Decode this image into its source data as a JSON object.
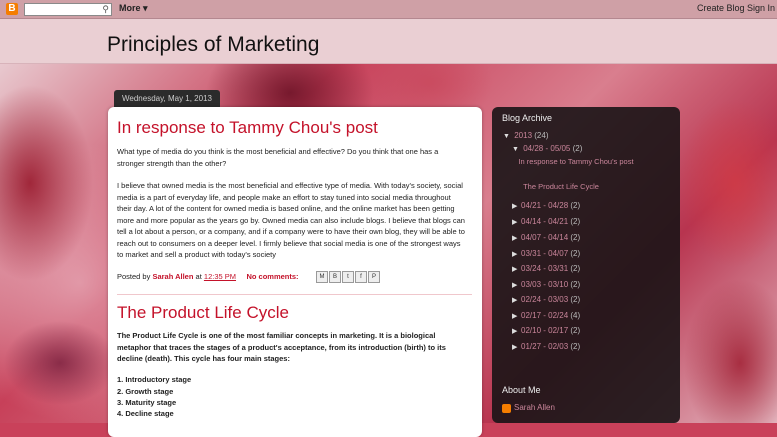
{
  "topbar": {
    "more": "More ▾",
    "create_blog": "Create Blog",
    "sign_in": "Sign In"
  },
  "blog": {
    "title": "Principles of Marketing"
  },
  "date_header": "Wednesday, May 1, 2013",
  "posts": [
    {
      "title": "In response to Tammy Chou's post",
      "p1": "What type of media do you think is the most beneficial and effective? Do you think that one has a stronger strength than the other?",
      "p2": "I believe that owned media is the most beneficial and effective type of media. With today's society, social media is a part of everyday life, and people make an effort to stay tuned into social media throughout their day. A lot of the content for owned media is based online, and the online market has been getting more and more popular as the years go by. Owned media can also include blogs. I believe that blogs can tell a lot about a person, or a company, and if a company were to have their own blog, they will be able to reach out to consumers on a deeper level. I firmly believe that social media is one of the strongest ways to market and sell a product with today's society",
      "posted_by": "Posted by",
      "author": "Sarah Allen",
      "at": "at",
      "time": "12:35 PM",
      "comments": "No comments:"
    },
    {
      "title": "The Product Life Cycle",
      "p1": "The Product Life Cycle is one of the most familiar concepts in marketing. It is a biological metaphor that traces the stages of a product's acceptance, from its introduction (birth) to its decline (death). This cycle has four main stages:",
      "stages": [
        "1. Introductory stage",
        "2. Growth stage",
        "3. Maturity stage",
        "4. Decline stage"
      ]
    }
  ],
  "share_buttons": [
    "M",
    "B",
    "t",
    "f",
    "P"
  ],
  "sidebar": {
    "archive_heading": "Blog Archive",
    "year": {
      "label": "2013",
      "count": "(24)"
    },
    "month_open": {
      "label": "04/28 - 05/05",
      "count": "(2)"
    },
    "open_posts": [
      "In response to Tammy Chou's post",
      "The Product Life Cycle"
    ],
    "weeks": [
      {
        "label": "04/21 - 04/28",
        "count": "(2)"
      },
      {
        "label": "04/14 - 04/21",
        "count": "(2)"
      },
      {
        "label": "04/07 - 04/14",
        "count": "(2)"
      },
      {
        "label": "03/31 - 04/07",
        "count": "(2)"
      },
      {
        "label": "03/24 - 03/31",
        "count": "(2)"
      },
      {
        "label": "03/03 - 03/10",
        "count": "(2)"
      },
      {
        "label": "02/24 - 03/03",
        "count": "(2)"
      },
      {
        "label": "02/17 - 02/24",
        "count": "(4)"
      },
      {
        "label": "02/10 - 02/17",
        "count": "(2)"
      },
      {
        "label": "01/27 - 02/03",
        "count": "(2)"
      }
    ],
    "about_heading": "About Me",
    "about_name": "Sarah Allen"
  },
  "colors": {
    "accent": "#c4122a",
    "sidebar_link": "#c9859a",
    "blogger_orange": "#f57d00"
  }
}
